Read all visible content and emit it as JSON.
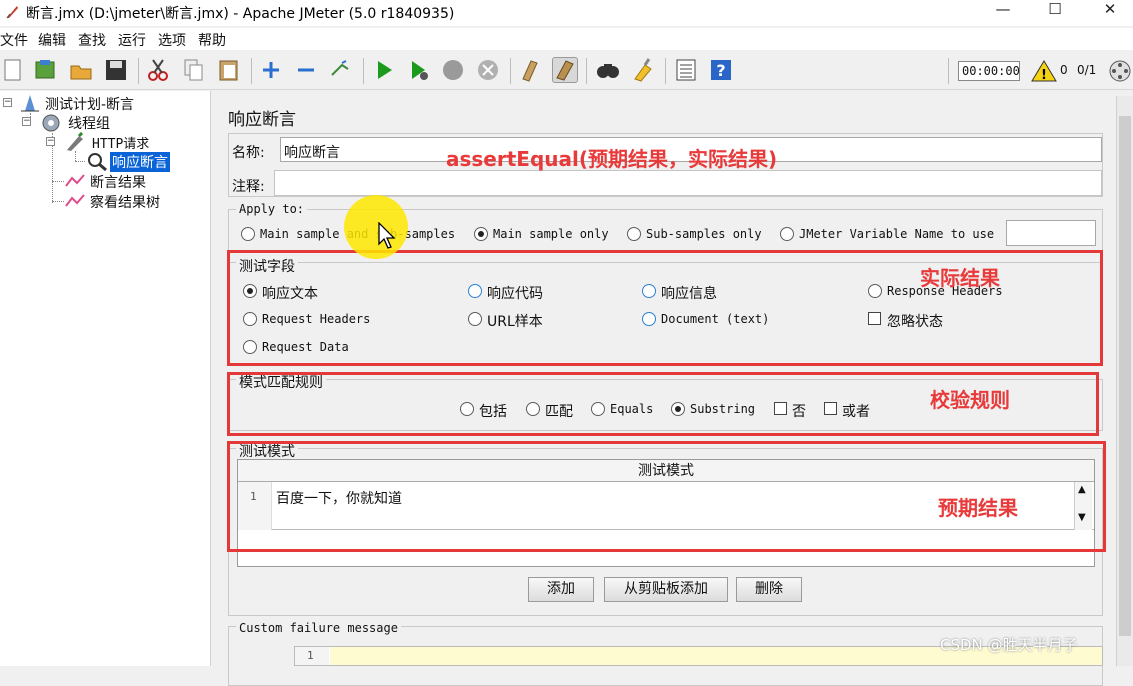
{
  "window": {
    "title": "断言.jmx (D:\\jmeter\\断言.jmx) - Apache JMeter (5.0 r1840935)",
    "minimize": "—",
    "maximize": "☐",
    "close": "✕"
  },
  "menu": [
    "文件",
    "编辑",
    "查找",
    "运行",
    "选项",
    "帮助"
  ],
  "toolbar": {
    "icons": [
      "new-icon",
      "templates-icon",
      "open-icon",
      "save-icon",
      "cut-icon",
      "copy-icon",
      "paste-icon",
      "expand-icon",
      "collapse-icon",
      "toggle-icon",
      "start-icon",
      "start-no-pause-icon",
      "stop-icon",
      "shutdown-icon",
      "clear-icon",
      "clear-all-icon",
      "search-icon",
      "reset-search-icon",
      "function-helper-icon",
      "help-icon"
    ],
    "timer": "00:00:00",
    "warn_count": "0",
    "thread_count": "0/1"
  },
  "tree": {
    "root": "测试计划-断言",
    "thread_group": "线程组",
    "http_request": "HTTP请求",
    "assertion": "响应断言",
    "assertion_results": "断言结果",
    "view_results_tree": "察看结果树"
  },
  "panel": {
    "title": "响应断言",
    "name_label": "名称:",
    "name_value": "响应断言",
    "comment_label": "注释:",
    "comment_value": "",
    "apply_to": {
      "title": "Apply to:",
      "options": [
        "Main sample and sub-samples",
        "Main sample only",
        "Sub-samples only",
        "JMeter Variable Name to use"
      ],
      "selected": "Main sample only",
      "var_name": ""
    },
    "field_to_test": {
      "title": "测试字段",
      "options": [
        "响应文本",
        "响应代码",
        "响应信息",
        "Response Headers",
        "Request Headers",
        "URL样本",
        "Document (text)",
        "Request Data"
      ],
      "selected": "响应文本",
      "ignore_status": "忽略状态",
      "ignore_status_checked": false
    },
    "matching_rules": {
      "title": "模式匹配规则",
      "options": [
        "包括",
        "匹配",
        "Equals",
        "Substring"
      ],
      "selected": "Substring",
      "not_label": "否",
      "or_label": "或者"
    },
    "patterns": {
      "title": "测试模式",
      "column": "测试模式",
      "rows": [
        {
          "num": "1",
          "value": "百度一下，你就知道"
        }
      ]
    },
    "buttons": {
      "add": "添加",
      "add_clipboard": "从剪贴板添加",
      "delete": "删除"
    },
    "custom_failure": {
      "title": "Custom failure message",
      "line": "1"
    }
  },
  "annotations": {
    "top": "assertEqual(预期结果，实际结果)",
    "actual": "实际结果",
    "rule": "校验规则",
    "expected": "预期结果",
    "color": "#e53838"
  },
  "watermark": "CSDN @胜天半月子"
}
